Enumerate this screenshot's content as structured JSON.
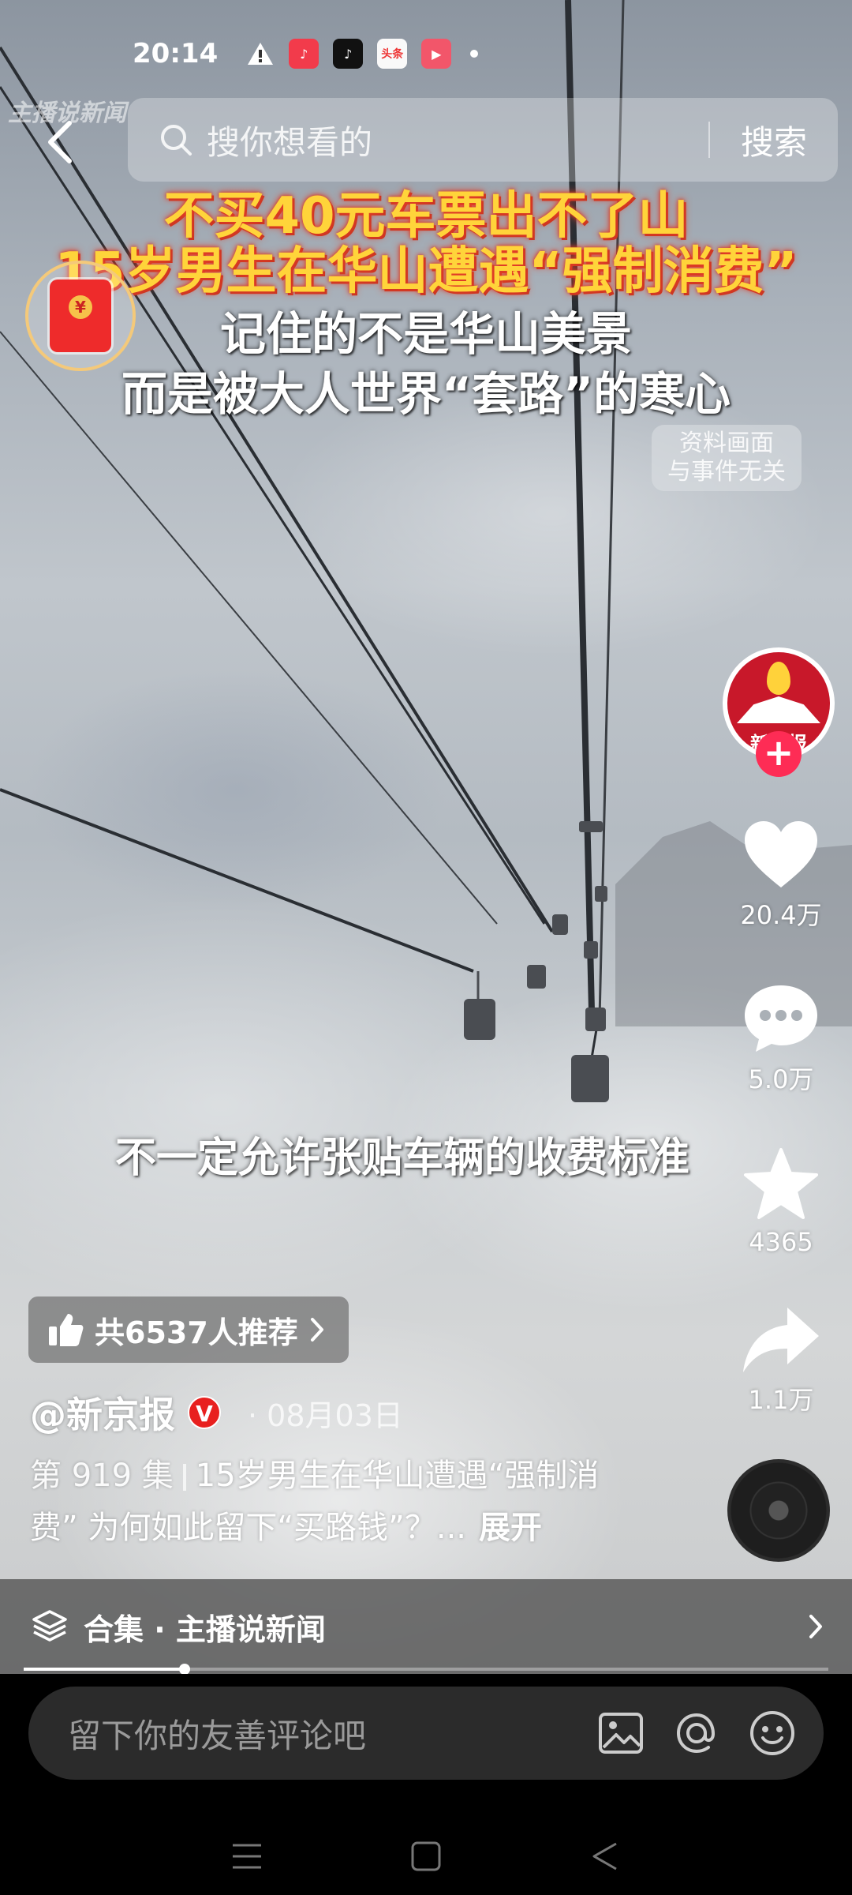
{
  "status_bar": {
    "time": "20:14",
    "icons": [
      "alert-icon",
      "music-app-icon",
      "tiktok-app-icon",
      "toutiao-app-icon",
      "video-app-icon"
    ],
    "toutiao_label": "头条"
  },
  "watermark": "主播说新闻",
  "search": {
    "placeholder": "搜你想看的",
    "button_label": "搜索"
  },
  "headline": {
    "line1": "不买40元车票出不了山",
    "line2": "15岁男生在华山遭遇“强制消费”",
    "line3": "记住的不是华山美景",
    "line4": "而是被大人世界“套路”的寒心"
  },
  "disclaimer": {
    "line1": "资料画面",
    "line2": "与事件无关"
  },
  "subtitle": "不一定允许张贴车辆的收费标准",
  "creator": {
    "avatar_text": "新京报",
    "follow_label": "+"
  },
  "actions": {
    "likes": "20.4万",
    "comments": "5.0万",
    "favorites": "4365",
    "shares": "1.1万"
  },
  "recommend": {
    "label": "共6537人推荐"
  },
  "author": {
    "name": "@新京报",
    "verified_mark": "V",
    "date": "· 08月03日"
  },
  "description": {
    "episode": "第 919 集",
    "text": "15岁男生在华山遭遇“强制消费” 为何如此留下“买路钱”？...",
    "expand_label": "展开"
  },
  "collection": {
    "label": "合集 · 主播说新闻"
  },
  "playback": {
    "progress_fraction": 0.2
  },
  "comment_bar": {
    "placeholder": "留下你的友善评论吧"
  },
  "colors": {
    "headline_yellow": "#ffd43a",
    "headline_glow": "#e8402a",
    "follow_pink": "#fe2c55",
    "verified_red": "#e8201f"
  }
}
